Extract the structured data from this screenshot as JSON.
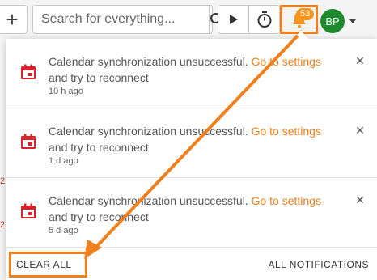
{
  "toolbar": {
    "add_label": "+",
    "search_placeholder": "Search for everything...",
    "bell_badge": "53",
    "avatar_initials": "BP"
  },
  "notifications": [
    {
      "text_before": "Calendar synchronization unsuccessful. ",
      "link": "Go to settings",
      "text_after": " and try to reconnect",
      "time": "10 h ago"
    },
    {
      "text_before": "Calendar synchronization unsuccessful. ",
      "link": "Go to settings",
      "text_after": " and try to reconnect",
      "time": "1 d ago"
    },
    {
      "text_before": "Calendar synchronization unsuccessful. ",
      "link": "Go to settings",
      "text_after": " and try to reconnect",
      "time": "5 d ago"
    }
  ],
  "footer": {
    "clear_all": "CLEAR ALL",
    "all_notifications": "ALL NOTIFICATIONS"
  },
  "background": {
    "hint_1": "2",
    "hint_2": "2"
  },
  "colors": {
    "accent": "#f07f1d",
    "calendar_icon": "#d8232a",
    "avatar": "#1e8a2e"
  }
}
